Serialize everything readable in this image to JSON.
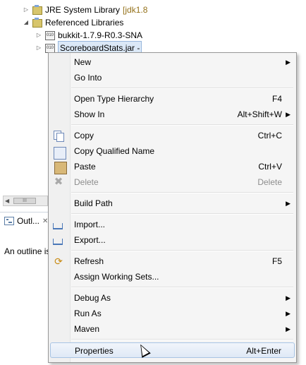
{
  "tree": {
    "top_partial": "",
    "rows": [
      {
        "label": "JRE System Library",
        "suffix": "[jdk1.8"
      },
      {
        "label": "Referenced Libraries"
      },
      {
        "label": "bukkit-1.7.9-R0.3-SNA"
      },
      {
        "label": "ScoreboardStats.jar -"
      }
    ],
    "jar_icon_text": "010"
  },
  "outline": {
    "tab_label": "Outl...",
    "close_glyph": "✕",
    "message": "An outline is"
  },
  "scrollbar": {
    "left_arrow": "◀",
    "thumb": "III"
  },
  "menu": {
    "items": [
      {
        "label": "New",
        "shortcut": "",
        "submenu": true
      },
      {
        "label": "Go Into",
        "shortcut": "",
        "submenu": false
      },
      {
        "label": "Open Type Hierarchy",
        "shortcut": "F4",
        "submenu": false
      },
      {
        "label": "Show In",
        "shortcut": "Alt+Shift+W",
        "submenu": true
      },
      {
        "label": "Copy",
        "shortcut": "Ctrl+C",
        "submenu": false
      },
      {
        "label": "Copy Qualified Name",
        "shortcut": "",
        "submenu": false
      },
      {
        "label": "Paste",
        "shortcut": "Ctrl+V",
        "submenu": false
      },
      {
        "label": "Delete",
        "shortcut": "Delete",
        "submenu": false,
        "disabled": true
      },
      {
        "label": "Build Path",
        "shortcut": "",
        "submenu": true
      },
      {
        "label": "Import...",
        "shortcut": "",
        "submenu": false
      },
      {
        "label": "Export...",
        "shortcut": "",
        "submenu": false
      },
      {
        "label": "Refresh",
        "shortcut": "F5",
        "submenu": false
      },
      {
        "label": "Assign Working Sets...",
        "shortcut": "",
        "submenu": false
      },
      {
        "label": "Debug As",
        "shortcut": "",
        "submenu": true
      },
      {
        "label": "Run As",
        "shortcut": "",
        "submenu": true
      },
      {
        "label": "Maven",
        "shortcut": "",
        "submenu": true
      },
      {
        "label": "Properties",
        "shortcut": "Alt+Enter",
        "submenu": false,
        "highlighted": true
      }
    ],
    "submenu_arrow": "▶"
  },
  "icons": {
    "copy": "copy-icon",
    "copy_qualified_name": "copy-qualified-name-icon",
    "paste": "paste-icon",
    "delete": "delete-icon",
    "import": "import-icon",
    "export": "export-icon",
    "refresh": "refresh-icon"
  },
  "colors": {
    "menu_background": "#f5f5f5",
    "highlight_border": "#a8c4e4",
    "disabled_text": "#8d8d8d",
    "library_suffix": "#94711a"
  }
}
